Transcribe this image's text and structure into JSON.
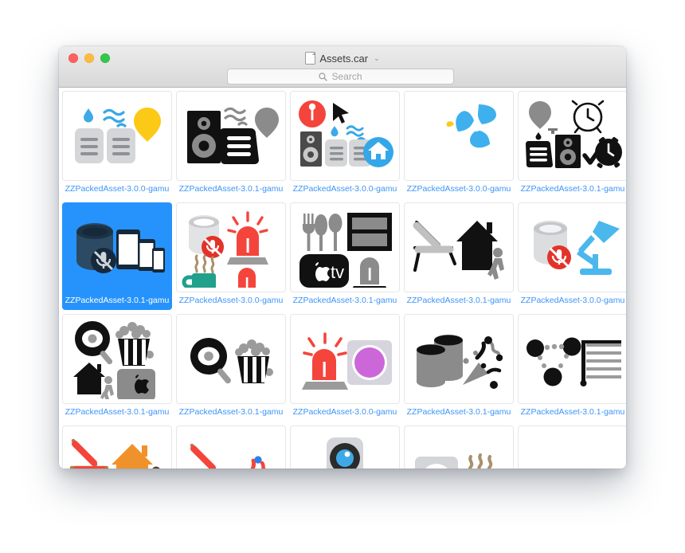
{
  "window": {
    "title": "Assets.car",
    "title_icon": "document-icon",
    "title_chevron": "⌄",
    "traffic_lights": [
      {
        "name": "close-button",
        "color": "#fc615d"
      },
      {
        "name": "minimize-button",
        "color": "#fdbc40"
      },
      {
        "name": "zoom-button",
        "color": "#34c749"
      }
    ]
  },
  "search": {
    "placeholder": "Search",
    "value": "",
    "icon": "search-icon"
  },
  "colors": {
    "selection_blue": "#2693fc",
    "label_blue": "#3c95f7",
    "titlebar_top": "#ececec",
    "titlebar_bottom": "#d8d8d8",
    "accent_red": "#f4453c",
    "accent_orange": "#f0922b",
    "accent_yellow": "#fcc917",
    "accent_teal": "#21a08b",
    "accent_blue": "#4ab8ec",
    "accent_purple": "#cc67d9"
  },
  "grid": {
    "columns": 5,
    "rows": 4,
    "cells": [
      {
        "id": "r1c1",
        "label": "ZZPackedAsset-3.0.0-gamu",
        "selected": false,
        "icons": [
          "water-drop-icon",
          "wave-lines-icon",
          "yellow-bulb-icon",
          "vent-icon",
          "vent-icon"
        ]
      },
      {
        "id": "r1c2",
        "label": "ZZPackedAsset-3.0.1-gamu",
        "selected": false,
        "icons": [
          "speaker-icon",
          "wave-lines-icon",
          "vent-dark-icon",
          "grey-bulb-icon"
        ]
      },
      {
        "id": "r1c3",
        "label": "ZZPackedAsset-3.0.0-gamu",
        "selected": false,
        "icons": [
          "location-pin-icon",
          "cursor-arrow-icon",
          "speaker-icon",
          "water-drop-icon",
          "wave-lines-icon",
          "vent-icon",
          "home-circle-icon"
        ]
      },
      {
        "id": "r1c4",
        "label": "ZZPackedAsset-3.0.0-gamu",
        "selected": false,
        "icons": [
          "yellow-sliver-icon",
          "fan-icon"
        ]
      },
      {
        "id": "r1c5",
        "label": "ZZPackedAsset-3.0.1-gamu",
        "selected": false,
        "icons": [
          "grey-bulb-icon",
          "alarm-clock-outline-icon",
          "vent-dark-icon",
          "speaker-icon",
          "checkmark-icon",
          "alarm-clock-solid-icon"
        ]
      },
      {
        "id": "r2c1",
        "label": "ZZPackedAsset-3.0.1-gamu",
        "selected": true,
        "icons": [
          "homepod-icon",
          "mic-off-badge-icon",
          "ipad-icon",
          "ipad-mini-icon",
          "iphone-icon"
        ]
      },
      {
        "id": "r2c2",
        "label": "ZZPackedAsset-3.0.0-gamu",
        "selected": false,
        "icons": [
          "homepod-icon",
          "mic-off-badge-icon",
          "siren-icon",
          "steam-icon",
          "mug-icon",
          "siren-small-icon"
        ]
      },
      {
        "id": "r2c3",
        "label": "ZZPackedAsset-3.0.1-gamu",
        "selected": false,
        "icons": [
          "fork-icon",
          "knife-icon",
          "spoon-icon",
          "window-blinds-icon",
          "apple-tv-icon",
          "siren-grey-icon"
        ]
      },
      {
        "id": "r2c4",
        "label": "ZZPackedAsset-3.0.1-gamu",
        "selected": false,
        "icons": [
          "lounge-chair-icon",
          "house-icon",
          "walking-person-icon"
        ]
      },
      {
        "id": "r2c5",
        "label": "ZZPackedAsset-3.0.0-gamu",
        "selected": false,
        "icons": [
          "homepod-icon",
          "mic-off-badge-icon",
          "desk-lamp-icon"
        ]
      },
      {
        "id": "r3c1",
        "label": "ZZPackedAsset-3.0.1-gamu",
        "selected": false,
        "icons": [
          "frying-pan-egg-icon",
          "popcorn-icon",
          "house-icon",
          "walking-person-icon",
          "mac-mini-apple-icon"
        ]
      },
      {
        "id": "r3c2",
        "label": "ZZPackedAsset-3.0.1-gamu",
        "selected": false,
        "icons": [
          "frying-pan-egg-icon",
          "popcorn-icon"
        ]
      },
      {
        "id": "r3c3",
        "label": "ZZPackedAsset-3.0.0-gamu",
        "selected": false,
        "icons": [
          "siren-icon",
          "purple-circle-square-icon"
        ]
      },
      {
        "id": "r3c4",
        "label": "ZZPackedAsset-3.0.1-gamu",
        "selected": false,
        "icons": [
          "trash-bins-icon",
          "party-popper-icon"
        ]
      },
      {
        "id": "r3c5",
        "label": "ZZPackedAsset-3.0.1-gamu",
        "selected": false,
        "icons": [
          "network-nodes-icon",
          "blinds-lines-icon"
        ]
      },
      {
        "id": "r4c1",
        "label": "",
        "selected": false,
        "icons": [
          "lounge-chair-red-icon",
          "orange-house-icon",
          "walking-person-icon",
          "stones-icon"
        ]
      },
      {
        "id": "r4c2",
        "label": "",
        "selected": false,
        "icons": [
          "lounge-chair-red-icon",
          "confetti-icon"
        ]
      },
      {
        "id": "r4c3",
        "label": "",
        "selected": false,
        "icons": [
          "camera-robot-icon"
        ]
      },
      {
        "id": "r4c4",
        "label": "",
        "selected": false,
        "icons": [
          "power-outlet-icon",
          "steam-icon",
          "mug-icon"
        ]
      },
      {
        "id": "r4c5",
        "label": "",
        "selected": false,
        "icons": [
          "small-dark-icon",
          "sparkle-dots-icon"
        ]
      }
    ]
  }
}
